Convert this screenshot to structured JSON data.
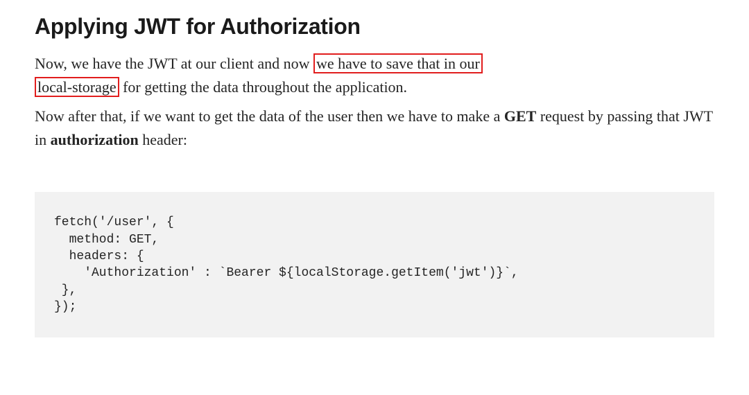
{
  "article": {
    "heading": "Applying JWT for Authorization",
    "para1": {
      "seg1": "Now, we have the JWT at our client and now ",
      "highlight1": "we have to save that in our",
      "newline_marker": " ",
      "highlight2": "local-storage",
      "seg2": " for getting the data throughout the application."
    },
    "para2": {
      "seg1": "Now after that, if we want to get the data of the user then we have to make a ",
      "bold1": "GET",
      "seg2": " request by passing that JWT in ",
      "bold2": "authorization",
      "seg3": " header:"
    },
    "code": "fetch('/user', {\n  method: GET,\n  headers: {\n    'Authorization' : `Bearer ${localStorage.getItem('jwt')}`,\n },\n});"
  }
}
